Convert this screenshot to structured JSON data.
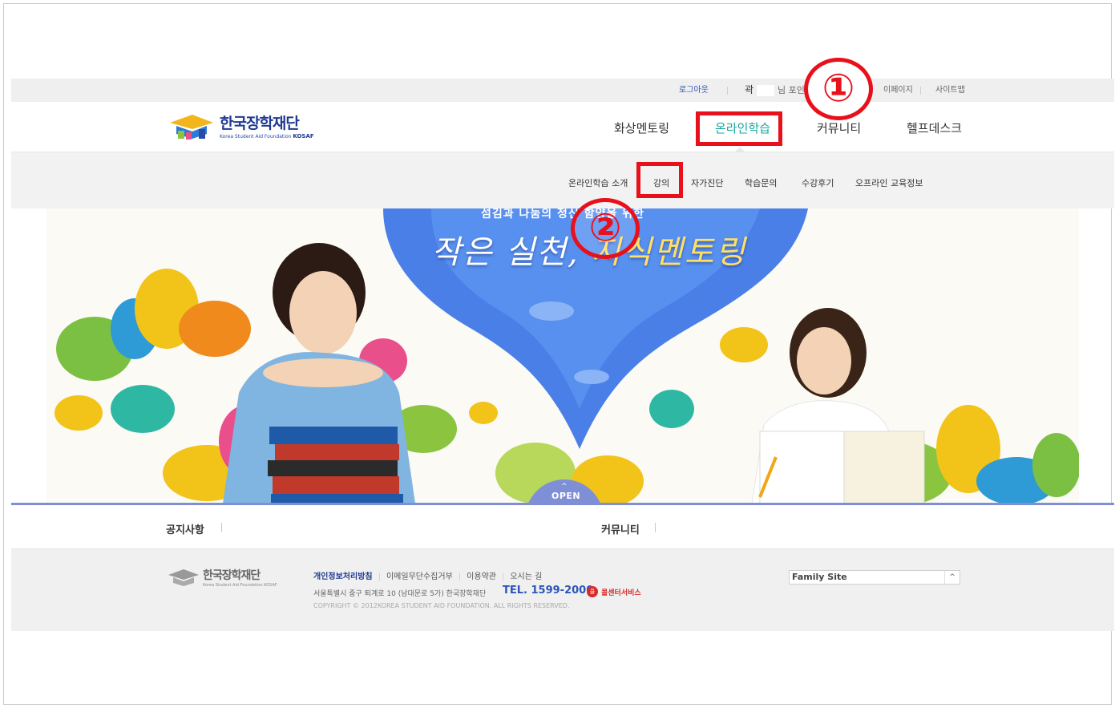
{
  "utility": {
    "logout": "로그아웃",
    "user_name": "곽",
    "points_label": "님 포인트",
    "mypage": "이페이지",
    "sitemap": "사이트맵"
  },
  "header": {
    "logo_ko": "한국장학재단",
    "logo_en": "Korea Student Aid Foundation",
    "logo_en_bold": "KOSAF",
    "gnb": [
      "화상멘토링",
      "온라인학습",
      "커뮤니티",
      "헬프데스크"
    ]
  },
  "subnav": [
    "온라인학습 소개",
    "강의",
    "자가진단",
    "학습문의",
    "수강후기",
    "오프라인 교육정보"
  ],
  "markers": {
    "one": "①",
    "two": "②"
  },
  "banner": {
    "tagline": "섬김과 나눔의 정신 함양을 위한",
    "headline_a": "작은 실천, ",
    "headline_b": "지식멘토링",
    "open": "OPEN",
    "open_arrow": "^"
  },
  "bottom_tabs": [
    "공지사항",
    "커뮤니티"
  ],
  "footer": {
    "logo_ko": "한국장학재단",
    "logo_en": "Korea Student Aid Foundation KOSAF",
    "links": [
      "개인정보처리방침",
      "이메일무단수집거부",
      "이용약관",
      "오시는 길"
    ],
    "address": "서울특별시 중구 퇴계로 10 (남대문로 5가) 한국장학재단",
    "tel": "TEL. 1599-2000",
    "call_icon": "콜",
    "call": "콜센터서비스",
    "copyright": "COPYRIGHT © 2012KOREA STUDENT AID FOUNDATION. ALL RIGHTS RESERVED.",
    "family_site": "Family Site",
    "family_arrow": "^"
  },
  "colors": {
    "accent_teal": "#17a79f",
    "brand_blue": "#1f3a93",
    "highlight_red": "#e8101a"
  }
}
